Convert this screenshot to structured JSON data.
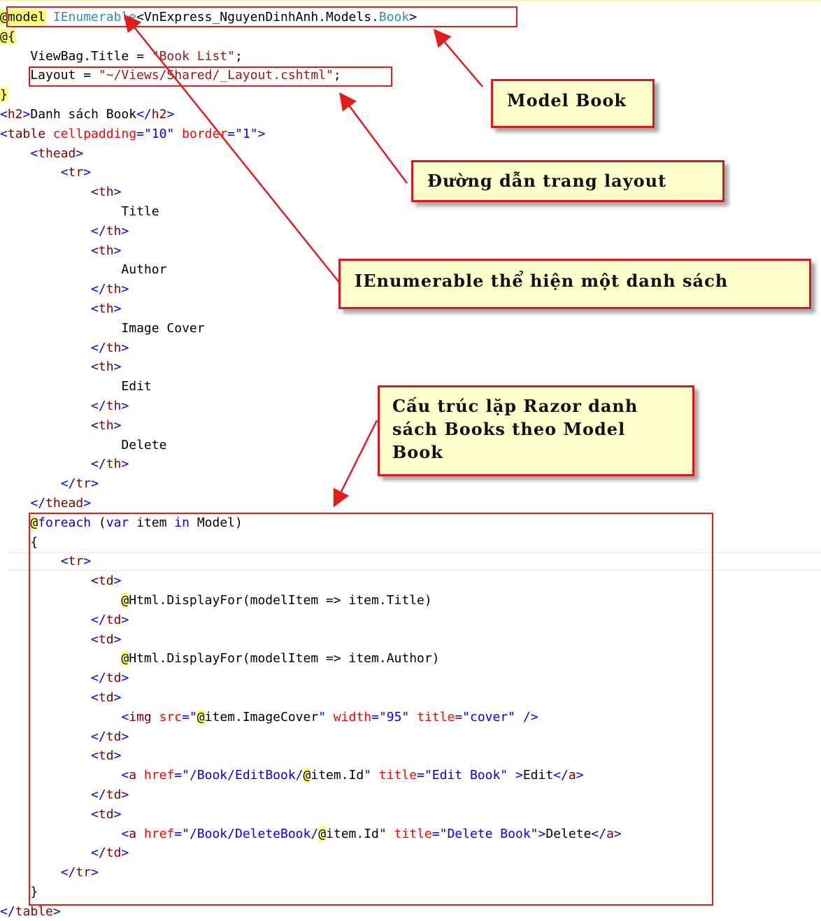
{
  "code_lines": [
    [
      [
        "razor",
        "@model"
      ],
      [
        "plain",
        " "
      ],
      [
        "type",
        "IEnumerable"
      ],
      [
        "plain",
        "<VnExpress_NguyenDinhAnh.Models."
      ],
      [
        "type",
        "Book"
      ],
      [
        "plain",
        ">"
      ]
    ],
    [
      [
        "razor",
        "@{"
      ]
    ],
    [
      [
        "plain",
        "    ViewBag.Title = "
      ],
      [
        "str",
        "\"Book List\""
      ],
      [
        "plain",
        ";"
      ]
    ],
    [
      [
        "plain",
        "    Layout = "
      ],
      [
        "str",
        "\"~/Views/Shared/_Layout.cshtml\""
      ],
      [
        "plain",
        ";"
      ]
    ],
    [
      [
        "razor",
        "}"
      ]
    ],
    [
      [
        "html",
        "<"
      ],
      [
        "tag",
        "h2"
      ],
      [
        "html",
        ">"
      ],
      [
        "plain",
        "Danh sách Book"
      ],
      [
        "html",
        "</"
      ],
      [
        "tag",
        "h2"
      ],
      [
        "html",
        ">"
      ]
    ],
    [
      [
        "html",
        "<"
      ],
      [
        "tag",
        "table"
      ],
      [
        "plain",
        " "
      ],
      [
        "attr",
        "cellpadding"
      ],
      [
        "html",
        "="
      ],
      [
        "html",
        "\"10\""
      ],
      [
        "plain",
        " "
      ],
      [
        "attr",
        "border"
      ],
      [
        "html",
        "="
      ],
      [
        "html",
        "\"1\""
      ],
      [
        "html",
        ">"
      ]
    ],
    [
      [
        "plain",
        "    "
      ],
      [
        "html",
        "<"
      ],
      [
        "tag",
        "thead"
      ],
      [
        "html",
        ">"
      ]
    ],
    [
      [
        "plain",
        "        "
      ],
      [
        "html",
        "<"
      ],
      [
        "tag",
        "tr"
      ],
      [
        "html",
        ">"
      ]
    ],
    [
      [
        "plain",
        "            "
      ],
      [
        "html",
        "<"
      ],
      [
        "tag",
        "th"
      ],
      [
        "html",
        ">"
      ]
    ],
    [
      [
        "plain",
        "                Title"
      ]
    ],
    [
      [
        "plain",
        "            "
      ],
      [
        "html",
        "</"
      ],
      [
        "tag",
        "th"
      ],
      [
        "html",
        ">"
      ]
    ],
    [
      [
        "plain",
        "            "
      ],
      [
        "html",
        "<"
      ],
      [
        "tag",
        "th"
      ],
      [
        "html",
        ">"
      ]
    ],
    [
      [
        "plain",
        "                Author"
      ]
    ],
    [
      [
        "plain",
        "            "
      ],
      [
        "html",
        "</"
      ],
      [
        "tag",
        "th"
      ],
      [
        "html",
        ">"
      ]
    ],
    [
      [
        "plain",
        "            "
      ],
      [
        "html",
        "<"
      ],
      [
        "tag",
        "th"
      ],
      [
        "html",
        ">"
      ]
    ],
    [
      [
        "plain",
        "                Image Cover"
      ]
    ],
    [
      [
        "plain",
        "            "
      ],
      [
        "html",
        "</"
      ],
      [
        "tag",
        "th"
      ],
      [
        "html",
        ">"
      ]
    ],
    [
      [
        "plain",
        "            "
      ],
      [
        "html",
        "<"
      ],
      [
        "tag",
        "th"
      ],
      [
        "html",
        ">"
      ]
    ],
    [
      [
        "plain",
        "                Edit"
      ]
    ],
    [
      [
        "plain",
        "            "
      ],
      [
        "html",
        "</"
      ],
      [
        "tag",
        "th"
      ],
      [
        "html",
        ">"
      ]
    ],
    [
      [
        "plain",
        "            "
      ],
      [
        "html",
        "<"
      ],
      [
        "tag",
        "th"
      ],
      [
        "html",
        ">"
      ]
    ],
    [
      [
        "plain",
        "                Delete"
      ]
    ],
    [
      [
        "plain",
        "            "
      ],
      [
        "html",
        "</"
      ],
      [
        "tag",
        "th"
      ],
      [
        "html",
        ">"
      ]
    ],
    [
      [
        "plain",
        "        "
      ],
      [
        "html",
        "</"
      ],
      [
        "tag",
        "tr"
      ],
      [
        "html",
        ">"
      ]
    ],
    [
      [
        "plain",
        "    "
      ],
      [
        "html",
        "</"
      ],
      [
        "tag",
        "thead"
      ],
      [
        "html",
        ">"
      ]
    ],
    [
      [
        "plain",
        "    "
      ],
      [
        "razor",
        "@"
      ],
      [
        "kw",
        "foreach"
      ],
      [
        "plain",
        " ("
      ],
      [
        "kw",
        "var"
      ],
      [
        "plain",
        " item "
      ],
      [
        "kw",
        "in"
      ],
      [
        "plain",
        " Model)"
      ]
    ],
    [
      [
        "plain",
        "    {"
      ]
    ],
    [
      [
        "plain",
        "        "
      ],
      [
        "html",
        "<"
      ],
      [
        "tag",
        "tr"
      ],
      [
        "html",
        ">"
      ]
    ],
    [
      [
        "plain",
        "            "
      ],
      [
        "html",
        "<"
      ],
      [
        "tag",
        "td"
      ],
      [
        "html",
        ">"
      ]
    ],
    [
      [
        "plain",
        "                "
      ],
      [
        "razor",
        "@"
      ],
      [
        "plain",
        "Html.DisplayFor(modelItem => item.Title)"
      ]
    ],
    [
      [
        "plain",
        "            "
      ],
      [
        "html",
        "</"
      ],
      [
        "tag",
        "td"
      ],
      [
        "html",
        ">"
      ]
    ],
    [
      [
        "plain",
        "            "
      ],
      [
        "html",
        "<"
      ],
      [
        "tag",
        "td"
      ],
      [
        "html",
        ">"
      ]
    ],
    [
      [
        "plain",
        "                "
      ],
      [
        "razor",
        "@"
      ],
      [
        "plain",
        "Html.DisplayFor(modelItem => item.Author)"
      ]
    ],
    [
      [
        "plain",
        "            "
      ],
      [
        "html",
        "</"
      ],
      [
        "tag",
        "td"
      ],
      [
        "html",
        ">"
      ]
    ],
    [
      [
        "plain",
        "            "
      ],
      [
        "html",
        "<"
      ],
      [
        "tag",
        "td"
      ],
      [
        "html",
        ">"
      ]
    ],
    [
      [
        "plain",
        "                "
      ],
      [
        "html",
        "<"
      ],
      [
        "tag",
        "img"
      ],
      [
        "plain",
        " "
      ],
      [
        "attr",
        "src"
      ],
      [
        "html",
        "=\""
      ],
      [
        "razor",
        "@"
      ],
      [
        "plain",
        "item.ImageCover"
      ],
      [
        "html",
        "\""
      ],
      [
        "plain",
        " "
      ],
      [
        "attr",
        "width"
      ],
      [
        "html",
        "="
      ],
      [
        "html",
        "\"95\""
      ],
      [
        "plain",
        " "
      ],
      [
        "attr",
        "title"
      ],
      [
        "html",
        "="
      ],
      [
        "html",
        "\"cover\""
      ],
      [
        "plain",
        " "
      ],
      [
        "html",
        "/>"
      ]
    ],
    [
      [
        "plain",
        "            "
      ],
      [
        "html",
        "</"
      ],
      [
        "tag",
        "td"
      ],
      [
        "html",
        ">"
      ]
    ],
    [
      [
        "plain",
        "            "
      ],
      [
        "html",
        "<"
      ],
      [
        "tag",
        "td"
      ],
      [
        "html",
        ">"
      ]
    ],
    [
      [
        "plain",
        "                "
      ],
      [
        "html",
        "<"
      ],
      [
        "tag",
        "a"
      ],
      [
        "plain",
        " "
      ],
      [
        "attr",
        "href"
      ],
      [
        "html",
        "=\"/Book/EditBook/"
      ],
      [
        "razor",
        "@"
      ],
      [
        "plain",
        "item.Id"
      ],
      [
        "html",
        "\""
      ],
      [
        "plain",
        " "
      ],
      [
        "attr",
        "title"
      ],
      [
        "html",
        "="
      ],
      [
        "html",
        "\"Edit Book\""
      ],
      [
        "plain",
        " "
      ],
      [
        "html",
        ">"
      ],
      [
        "plain",
        "Edit"
      ],
      [
        "html",
        "</"
      ],
      [
        "tag",
        "a"
      ],
      [
        "html",
        ">"
      ]
    ],
    [
      [
        "plain",
        "            "
      ],
      [
        "html",
        "</"
      ],
      [
        "tag",
        "td"
      ],
      [
        "html",
        ">"
      ]
    ],
    [
      [
        "plain",
        "            "
      ],
      [
        "html",
        "<"
      ],
      [
        "tag",
        "td"
      ],
      [
        "html",
        ">"
      ]
    ],
    [
      [
        "plain",
        "                "
      ],
      [
        "html",
        "<"
      ],
      [
        "tag",
        "a"
      ],
      [
        "plain",
        " "
      ],
      [
        "attr",
        "href"
      ],
      [
        "html",
        "=\"/Book/DeleteBook/"
      ],
      [
        "razor",
        "@"
      ],
      [
        "plain",
        "item.Id"
      ],
      [
        "html",
        "\""
      ],
      [
        "plain",
        " "
      ],
      [
        "attr",
        "title"
      ],
      [
        "html",
        "="
      ],
      [
        "html",
        "\"Delete Book\""
      ],
      [
        "html",
        ">"
      ],
      [
        "plain",
        "Delete"
      ],
      [
        "html",
        "</"
      ],
      [
        "tag",
        "a"
      ],
      [
        "html",
        ">"
      ]
    ],
    [
      [
        "plain",
        "            "
      ],
      [
        "html",
        "</"
      ],
      [
        "tag",
        "td"
      ],
      [
        "html",
        ">"
      ]
    ],
    [
      [
        "plain",
        "        "
      ],
      [
        "html",
        "</"
      ],
      [
        "tag",
        "tr"
      ],
      [
        "html",
        ">"
      ]
    ],
    [
      [
        "plain",
        "    }"
      ]
    ],
    [
      [
        "html",
        "</"
      ],
      [
        "tag",
        "table"
      ],
      [
        "html",
        ">"
      ]
    ]
  ],
  "callouts": {
    "model_book": "Model Book",
    "layout_path": "Đường dẫn trang layout",
    "ienumerable": "IEnumerable thể hiện một danh sách",
    "razor_loop": [
      "Cấu trúc lặp Razor danh",
      "sách Books theo Model",
      "Book"
    ]
  },
  "colors": {
    "callout_border": "#e0161f",
    "callout_fill": "#ffffcc",
    "arrow": "#e21b1b",
    "razor_highlight": "#ffff66",
    "html_delimiter": "#0000ff",
    "tag_name": "#800000",
    "attribute": "#ff0000",
    "string": "#a31515",
    "type": "#2b91af"
  }
}
